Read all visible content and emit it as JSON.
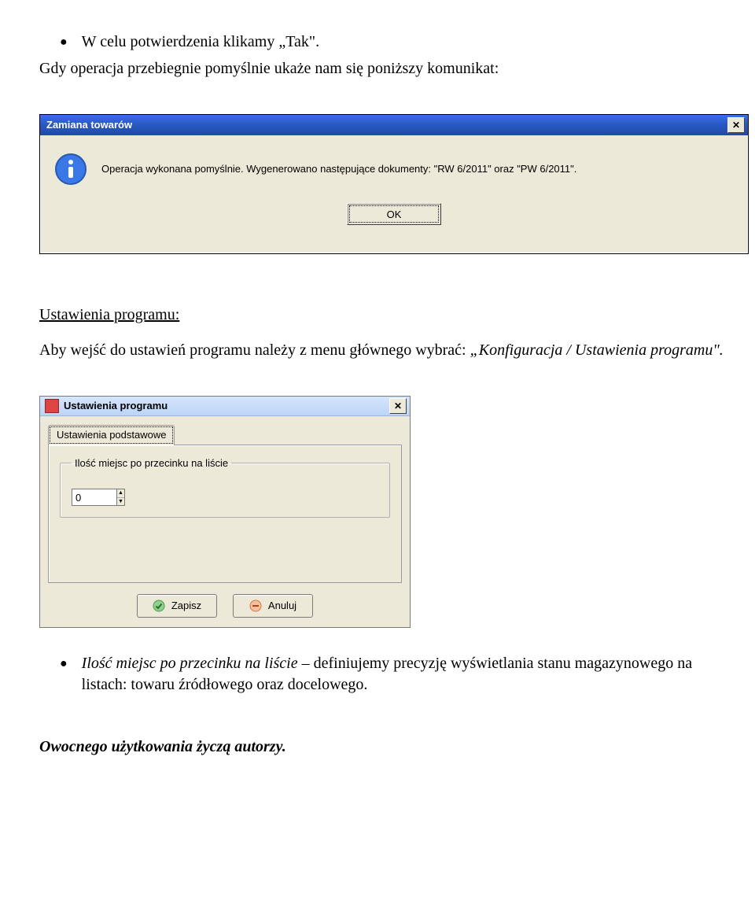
{
  "bullets": {
    "confirm": "W celu potwierdzenia klikamy „Tak\".",
    "places_intro": "Ilość miejsc po przecinku na liście",
    "places_rest": " – definiujemy precyzję wyświetlania stanu magazynowego na listach: towaru źródłowego oraz docelowego."
  },
  "paragraphs": {
    "success_intro": "Gdy operacja przebiegnie pomyślnie ukaże nam się poniższy komunikat:",
    "settings_heading": "Ustawienia programu:",
    "settings_body_a": "Aby wejść do ustawień programu należy z menu głównego wybrać: ",
    "settings_body_b": "„Konfiguracja / Ustawienia programu\".",
    "footer": "Owocnego użytkowania życzą autorzy."
  },
  "dialog1": {
    "title": "Zamiana towarów",
    "message": "Operacja wykonana pomyślnie. Wygenerowano następujące dokumenty: \"RW 6/2011\" oraz \"PW 6/2011\".",
    "ok": "OK"
  },
  "dialog2": {
    "title": "Ustawienia programu",
    "tab": "Ustawienia podstawowe",
    "group_legend": "Ilość miejsc po przecinku na liście",
    "spin_value": "0",
    "save": "Zapisz",
    "cancel": "Anuluj"
  }
}
